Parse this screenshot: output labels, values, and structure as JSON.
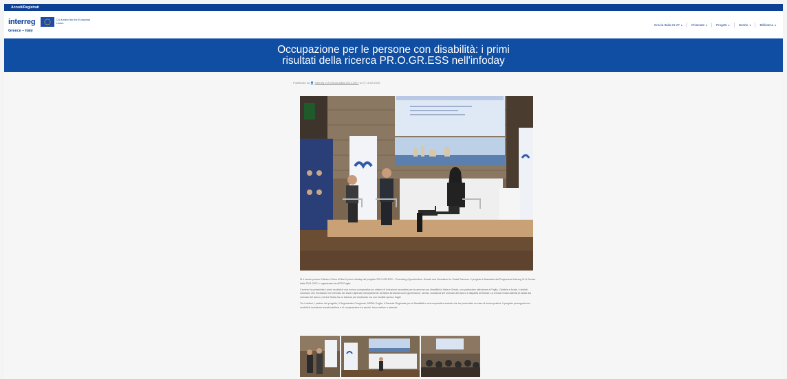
{
  "topbar": {
    "link": "Accedi/Registrati"
  },
  "header": {
    "logo_word": "interreg",
    "logo_sub": "Greece – Italy",
    "eu_text": "Co-funded by the European Union",
    "nav": [
      {
        "label": "Grecia-Italia 21-27",
        "has_caret": true
      },
      {
        "label": "Chiamate",
        "has_caret": true
      },
      {
        "label": "Progetti",
        "has_caret": true
      },
      {
        "label": "Notizie",
        "has_caret": true
      },
      {
        "label": "Biblioteca",
        "has_caret": true
      }
    ]
  },
  "banner": {
    "title_line1": "Occupazione per le persone con disabilità: i primi",
    "title_line2": "risultati della ricerca PR.O.GR.ESS nell'infoday"
  },
  "meta": {
    "prefix": "Pubblicato da",
    "author": "Interreg V-A Grecia-Italia 2021-2027",
    "on": "su",
    "date": "11/02/2025"
  },
  "article": {
    "p1": "Si è tenuto presso il Museo Civico di Bari il primo infoday del progetto PR.O.GR.ESS – Promoting Opportunities, Growth and Education for Social Success. Il progetto è finanziato dal Programma Interreg VI-A Grecia-Italia 2021-2027 e organizzato da ARTI Puglia.",
    "p2": "L'evento ha presentato i primi risultati di una ricerca comparativa sui sistemi di inclusione lavorativa per le persone con disabilità in Italia e Grecia, con particolare attenzione a Puglia, Calabria e Acaia. I risultati mostrano che l'inclusione nel mercato del lavoro dipende principalmente da fattori strutturali come governance, servizi, condizioni del mercato del lavoro e disparità territoriali. La Grecia mostra attività di uscita dal mercato del lavoro, mentre l'Italia ha un sistema più strutturato ma con risultati spesso fragili.",
    "p3": "Tra i relatori, i partner del progetto, il Segretariato Congiunto, ARPAL Puglia, il Garante Regionale per la Disabilità e una cooperativa sociale che ha presentato un caso di buona pratica. Il progetto proseguirà con modelli di inclusione transfrontaliera e di cooperazione tra servizi, terzo settore e aziende."
  },
  "colors": {
    "primary": "#0f4ea2",
    "topbar": "#0d3f94",
    "page_bg": "#f4f4f4"
  },
  "icons": {
    "author": "user-icon",
    "date": "clock-icon",
    "eu": "eu-flag-icon"
  }
}
